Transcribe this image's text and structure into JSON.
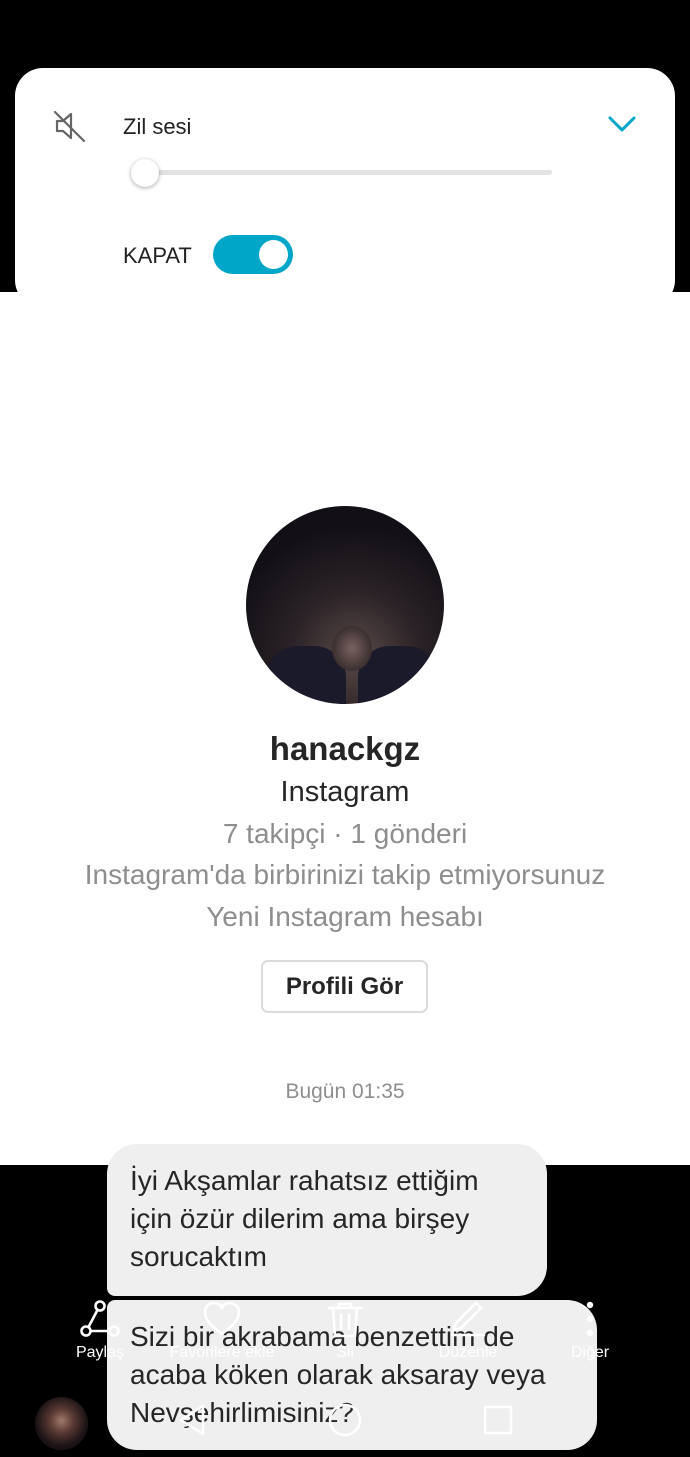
{
  "sound_panel": {
    "ring_label": "Zil sesi",
    "ring_volume_fraction": 0.0,
    "dnd_label": "KAPAT",
    "dnd_on": true,
    "accent": "#00A6C7"
  },
  "profile": {
    "username": "hanackgz",
    "platform": "Instagram",
    "stats": "7 takipçi · 1 gönderi",
    "follow_note": "Instagram'da birbirinizi takip etmiyorsunuz",
    "new_account": "Yeni Instagram hesabı",
    "view_profile_label": "Profili Gör"
  },
  "chat": {
    "timestamp": "Bugün 01:35",
    "messages": [
      {
        "text": "İyi Akşamlar rahatsız ettiğim için özür dilerim ama birşey sorucaktım"
      },
      {
        "text": "Sizi bir akrabama benzettim de acaba köken olarak aksaray veya Nevşehirlimisiniz?"
      }
    ]
  },
  "actions": [
    {
      "label": "Paylaş",
      "icon": "share-icon"
    },
    {
      "label": "Favorilere ekle",
      "icon": "heart-icon"
    },
    {
      "label": "Sil",
      "icon": "trash-icon"
    },
    {
      "label": "Düzenle",
      "icon": "pencil-icon"
    },
    {
      "label": "Diğer",
      "icon": "more-vertical-icon"
    }
  ],
  "nav": [
    "back-icon",
    "home-icon",
    "recents-icon"
  ]
}
